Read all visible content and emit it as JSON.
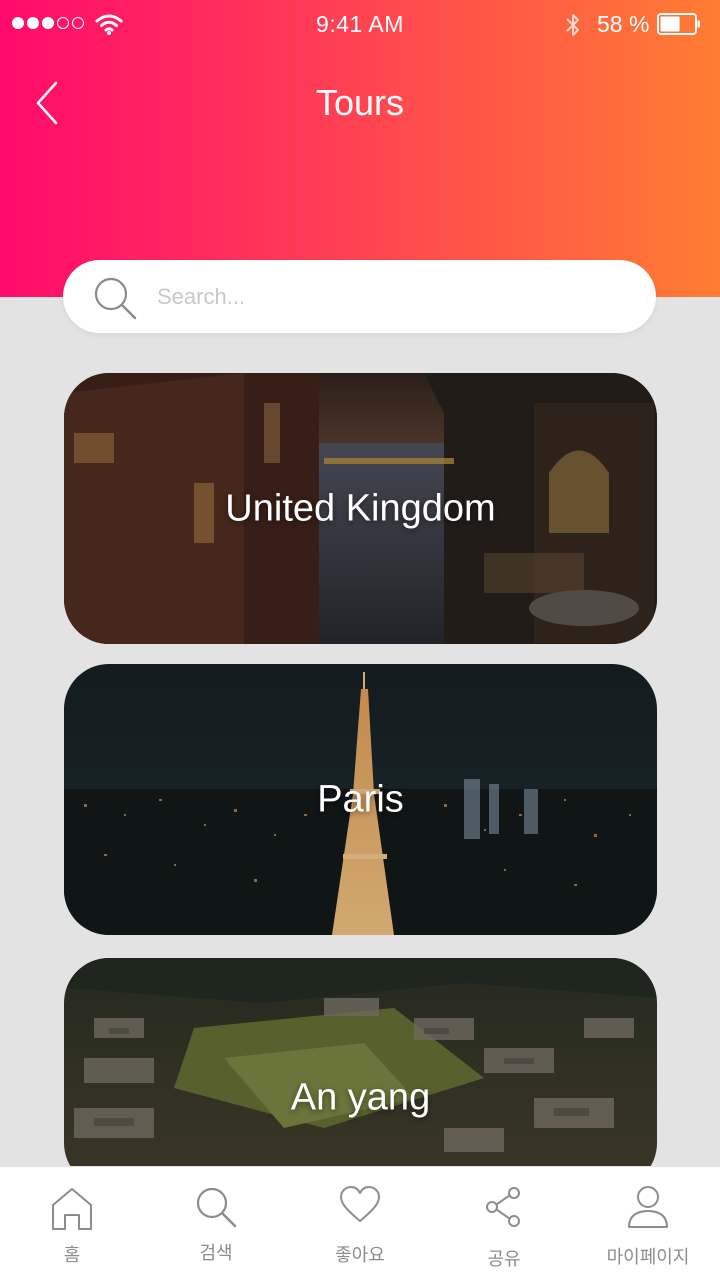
{
  "status_bar": {
    "time": "9:41 AM",
    "battery_percent": "58 %",
    "battery_level": 0.58,
    "signal_bars": 3,
    "signal_total": 5
  },
  "header": {
    "title": "Tours",
    "back_icon": "chevron-left-icon",
    "gradient_start": "#ff0a6c",
    "gradient_end": "#ff7d32"
  },
  "search": {
    "placeholder": "Search...",
    "value": "",
    "icon": "search-icon"
  },
  "tours": [
    {
      "label": "United Kingdom"
    },
    {
      "label": "Paris"
    },
    {
      "label": "An yang"
    }
  ],
  "tabbar": {
    "items": [
      {
        "label": "홈",
        "icon": "home-icon"
      },
      {
        "label": "검색",
        "icon": "search-icon"
      },
      {
        "label": "좋아요",
        "icon": "heart-icon"
      },
      {
        "label": "공유",
        "icon": "share-icon"
      },
      {
        "label": "마이페이지",
        "icon": "user-icon"
      }
    ]
  }
}
